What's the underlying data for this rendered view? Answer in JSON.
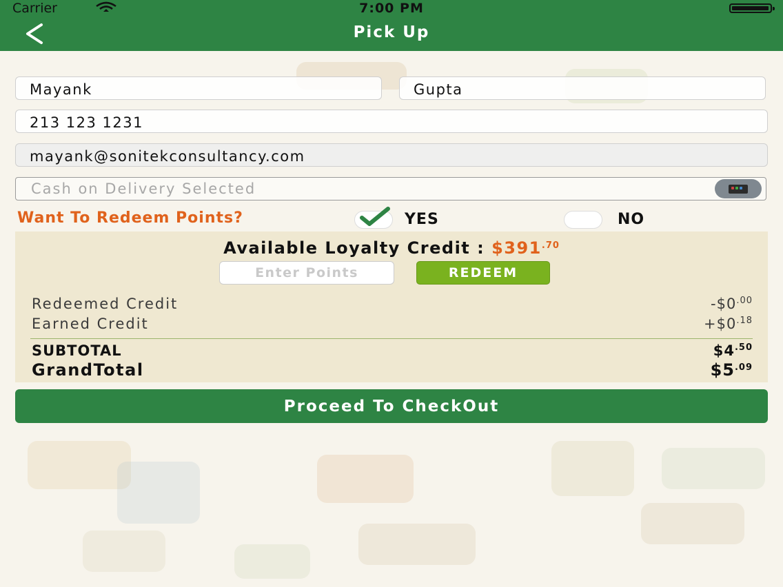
{
  "status_bar": {
    "carrier": "Carrier",
    "time": "7:00 PM"
  },
  "nav": {
    "title": "Pick Up"
  },
  "form": {
    "first_name": "Mayank",
    "last_name": "Gupta",
    "phone": "213 123 1231",
    "email": "mayank@sonitekconsultancy.com",
    "payment_method": "Cash on Delivery Selected"
  },
  "redeem": {
    "question": "Want To Redeem Points?",
    "yes_label": "YES",
    "no_label": "NO",
    "selected": "YES"
  },
  "loyalty": {
    "title": "Available Loyalty Credit :",
    "credit_main": "$391",
    "credit_cents": ".70",
    "points_placeholder": "Enter Points",
    "redeem_button": "REDEEM"
  },
  "summary": {
    "redeemed_label": "Redeemed Credit",
    "redeemed_main": "-$0",
    "redeemed_cents": ".00",
    "earned_label": "Earned Credit",
    "earned_main": "+$0",
    "earned_cents": ".18",
    "subtotal_label": "SUBTOTAL",
    "subtotal_main": "$4",
    "subtotal_cents": ".50",
    "grandtotal_label": "GrandTotal",
    "grandtotal_main": "$5",
    "grandtotal_cents": ".09"
  },
  "checkout_button": "Proceed To CheckOut",
  "colors": {
    "primary_green": "#2e8444",
    "accent_orange": "#e0621c",
    "redeem_green": "#7ab21f"
  }
}
